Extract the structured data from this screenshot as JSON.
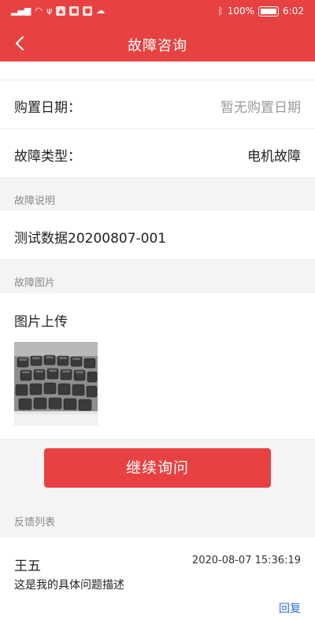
{
  "status_bar": {
    "battery": "100%",
    "time": "6:02"
  },
  "header": {
    "title": "故障咨询"
  },
  "fields": [
    {
      "label": "购置日期：",
      "value": "暂无购置日期"
    },
    {
      "label": "故障类型：",
      "value": "电机故障"
    }
  ],
  "description": {
    "section_label": "故障说明",
    "text": "测试数据20200807-001"
  },
  "images": {
    "section_label": "故障图片",
    "upload_title": "图片上传"
  },
  "actions": {
    "continue_label": "继续询问"
  },
  "feedback": {
    "section_label": "反馈列表",
    "items": [
      {
        "name": "王五",
        "time": "2020-08-07 15:36:19",
        "content": "这是我的具体问题描述",
        "reply_label": "回复"
      }
    ]
  },
  "colors": {
    "primary": "#e84141",
    "link": "#2b6de0",
    "muted": "#888888"
  }
}
